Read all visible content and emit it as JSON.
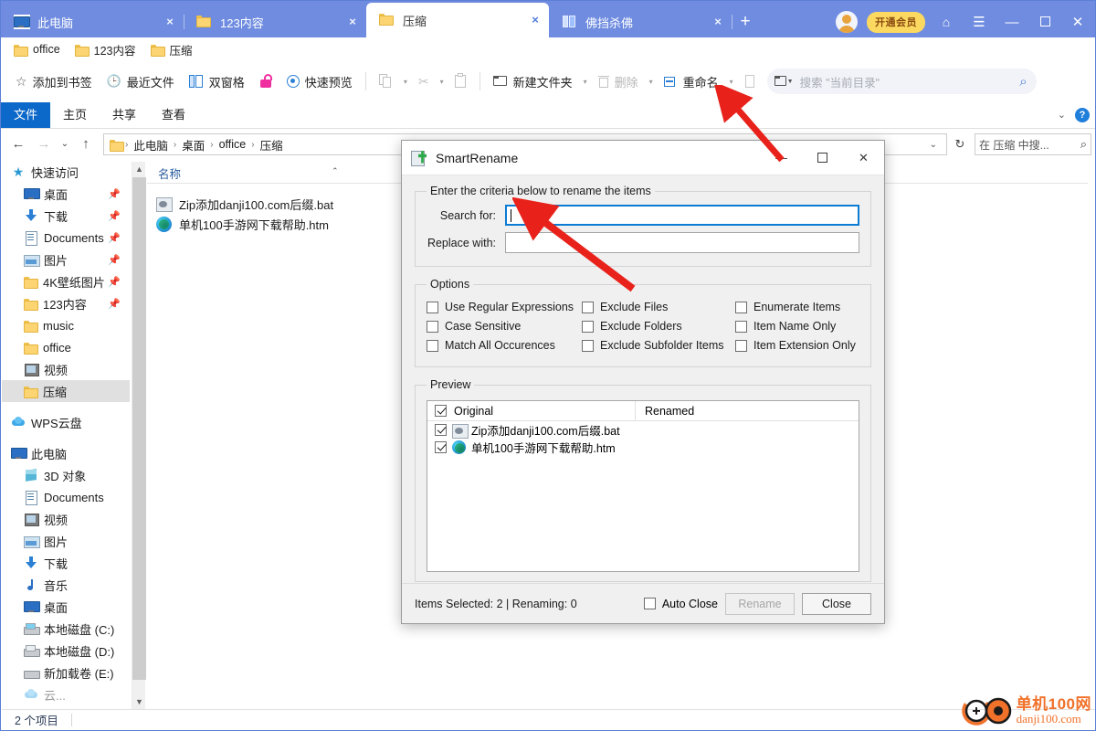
{
  "window": {
    "tabs": [
      {
        "label": "此电脑",
        "icon": "monitor-icon",
        "active": false
      },
      {
        "label": "123内容",
        "icon": "folder-icon",
        "active": false
      },
      {
        "label": "压缩",
        "icon": "folder-icon",
        "active": true
      },
      {
        "label": "佛挡杀佛",
        "icon": "dualpane-icon",
        "active": false
      }
    ],
    "new_tab_label": "+",
    "close_label": "×",
    "vip_button": "开通会员",
    "minimize": "—",
    "maximize": "❐",
    "close": "✕",
    "menu": "☰",
    "skin": "⌂"
  },
  "bookmarks": [
    {
      "label": "office"
    },
    {
      "label": "123内容"
    },
    {
      "label": "压缩"
    }
  ],
  "quickbar": {
    "items": [
      {
        "label": "添加到书签",
        "icon": "star-icon"
      },
      {
        "label": "最近文件",
        "icon": "clock-icon"
      },
      {
        "label": "双窗格",
        "icon": "dualpane-icon"
      },
      {
        "label": "",
        "icon": "unlock-icon"
      },
      {
        "label": "快速预览",
        "icon": "eye-icon"
      },
      {
        "label": "",
        "icon": "copy-icon"
      },
      {
        "label": "",
        "icon": "cut-icon"
      },
      {
        "label": "",
        "icon": "paste-icon"
      },
      {
        "label": "新建文件夹",
        "icon": "new-folder-icon"
      },
      {
        "label": "删除",
        "icon": "delete-icon"
      },
      {
        "label": "重命名",
        "icon": "rename-icon"
      },
      {
        "label": "",
        "icon": "properties-icon"
      },
      {
        "label": "",
        "icon": "folder-dropdown-icon"
      }
    ],
    "search_placeholder": "搜索 \"当前目录\""
  },
  "ribbon": {
    "tabs": [
      "文件",
      "主页",
      "共享",
      "查看"
    ],
    "active": "文件",
    "collapse": "⌄",
    "help": "?"
  },
  "address": {
    "back": "←",
    "forward": "→",
    "history": "⌄",
    "up": "↑",
    "crumbs": [
      "此电脑",
      "桌面",
      "office",
      "压缩"
    ],
    "dropdown": "⌄",
    "refresh": "↻",
    "search_label": "在 压缩 中搜...",
    "search_icon": "search-icon"
  },
  "sidebar": {
    "groups": [
      {
        "header": {
          "label": "快速访问",
          "icon": "star-icon"
        },
        "items": [
          {
            "label": "桌面",
            "icon": "desktop-icon",
            "pinned": true
          },
          {
            "label": "下载",
            "icon": "download-icon",
            "pinned": true
          },
          {
            "label": "Documents",
            "icon": "documents-icon",
            "pinned": true
          },
          {
            "label": "图片",
            "icon": "pictures-icon",
            "pinned": true
          },
          {
            "label": "4K壁纸图片",
            "icon": "folder-icon",
            "pinned": true
          },
          {
            "label": "123内容",
            "icon": "folder-icon",
            "pinned": true
          },
          {
            "label": "music",
            "icon": "folder-icon",
            "pinned": false
          },
          {
            "label": "office",
            "icon": "folder-icon",
            "pinned": false
          },
          {
            "label": "视频",
            "icon": "video-icon",
            "pinned": false
          },
          {
            "label": "压缩",
            "icon": "folder-icon",
            "pinned": false,
            "selected": true
          }
        ]
      },
      {
        "header": {
          "label": "WPS云盘",
          "icon": "cloud-icon"
        },
        "items": []
      },
      {
        "header": {
          "label": "此电脑",
          "icon": "monitor-icon"
        },
        "items": [
          {
            "label": "3D 对象",
            "icon": "3d-icon"
          },
          {
            "label": "Documents",
            "icon": "documents-icon"
          },
          {
            "label": "视频",
            "icon": "video-icon"
          },
          {
            "label": "图片",
            "icon": "pictures-icon"
          },
          {
            "label": "下载",
            "icon": "download-icon"
          },
          {
            "label": "音乐",
            "icon": "music-icon"
          },
          {
            "label": "桌面",
            "icon": "desktop-icon"
          },
          {
            "label": "本地磁盘 (C:)",
            "icon": "drive-system-icon"
          },
          {
            "label": "本地磁盘 (D:)",
            "icon": "drive-icon"
          },
          {
            "label": "新加载卷 (E:)",
            "icon": "drive-plain-icon"
          }
        ]
      }
    ]
  },
  "filelist": {
    "column_header": "名称",
    "sort_caret": "⌃",
    "rows": [
      {
        "name": "Zip添加danji100.com后缀.bat",
        "icon": "bat-file-icon"
      },
      {
        "name": "单机100手游网下载帮助.htm",
        "icon": "edge-file-icon"
      }
    ]
  },
  "statusbar": {
    "item_count": "2 个项目"
  },
  "dialog": {
    "title": "SmartRename",
    "icon": "smartrename-icon",
    "minimize": "—",
    "maximize": "☐",
    "close": "✕",
    "criteria_group": "Enter the criteria below to rename the items",
    "search_for_label": "Search for:",
    "search_for_value": "",
    "replace_with_label": "Replace with:",
    "replace_with_value": "",
    "options_group": "Options",
    "options": [
      [
        {
          "label": "Use Regular Expressions",
          "checked": false
        },
        {
          "label": "Case Sensitive",
          "checked": false
        },
        {
          "label": "Match All Occurences",
          "checked": false
        }
      ],
      [
        {
          "label": "Exclude Files",
          "checked": false
        },
        {
          "label": "Exclude Folders",
          "checked": false
        },
        {
          "label": "Exclude Subfolder Items",
          "checked": false
        }
      ],
      [
        {
          "label": "Enumerate Items",
          "checked": false
        },
        {
          "label": "Item Name Only",
          "checked": false
        },
        {
          "label": "Item Extension Only",
          "checked": false
        }
      ]
    ],
    "preview_group": "Preview",
    "preview_columns": {
      "original": "Original",
      "renamed": "Renamed",
      "header_checked": true
    },
    "preview_rows": [
      {
        "original": "Zip添加danji100.com后缀.bat",
        "renamed": "",
        "checked": true,
        "icon": "bat-file-icon"
      },
      {
        "original": "单机100手游网下载帮助.htm",
        "renamed": "",
        "checked": true,
        "icon": "edge-file-icon"
      }
    ],
    "status": "Items Selected: 2 | Renaming: 0",
    "auto_close_label": "Auto Close",
    "auto_close_checked": false,
    "rename_button": "Rename",
    "rename_enabled": false,
    "close_button": "Close"
  },
  "watermark": {
    "line1": "单机100网",
    "line2": "danji100.com"
  },
  "colors": {
    "tabbar": "#6f8ce0",
    "ribbon_active": "#0c68c9",
    "vip": "#fbd960",
    "accent_red": "#e8221b",
    "folder": "#fcd572",
    "watermark": "#f0712a"
  }
}
